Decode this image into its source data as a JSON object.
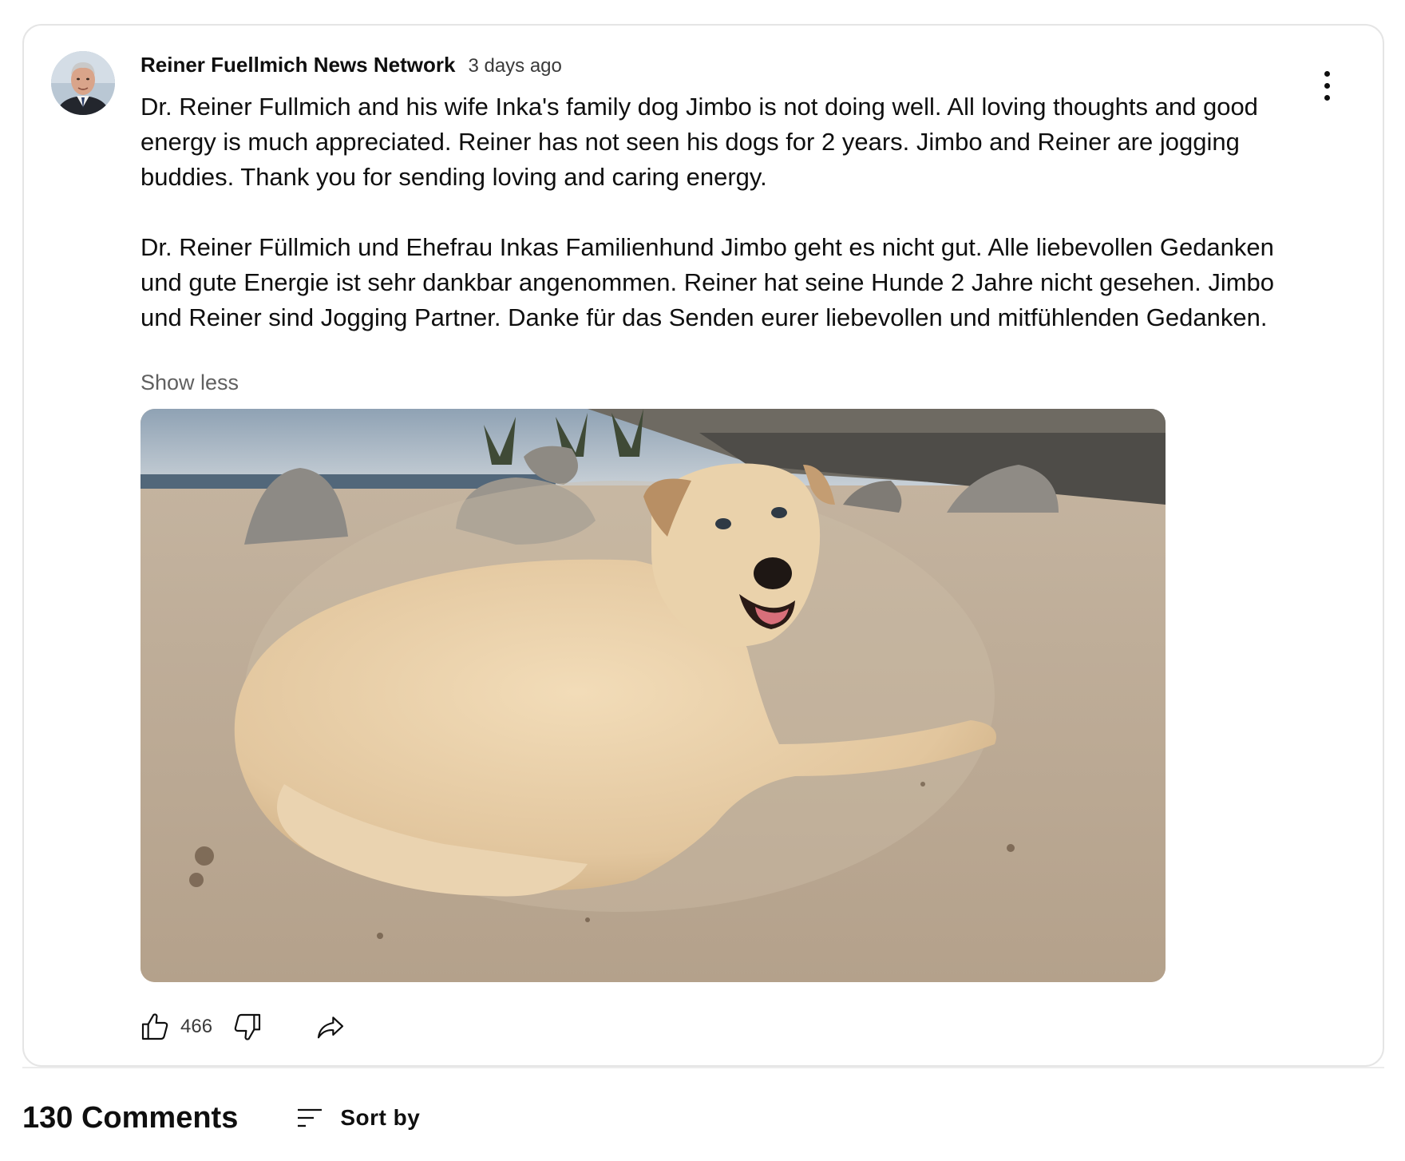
{
  "post": {
    "channel_name": "Reiner Fuellmich News Network",
    "time": "3 days ago",
    "paragraphs": [
      "Dr. Reiner Fullmich and his wife Inka's family dog Jimbo is not doing well. All loving thoughts and good energy is much appreciated. Reiner has not seen his dogs for 2 years. Jimbo and Reiner are jogging buddies. Thank you for sending loving and caring energy.",
      "Dr. Reiner Füllmich und Ehefrau Inkas Familienhund Jimbo geht es nicht gut. Alle liebevollen Gedanken und gute Energie ist sehr dankbar angenommen. Reiner hat seine Hunde 2 Jahre nicht gesehen. Jimbo und Reiner sind Jogging Partner. Danke für das Senden eurer liebevollen und mitfühlenden Gedanken."
    ],
    "show_less_label": "Show less",
    "like_count": "466"
  },
  "comments": {
    "count_label": "130 Comments",
    "sort_label": "Sort by"
  },
  "icons": {
    "avatar": "channel-avatar",
    "menu": "more-vert-icon",
    "like": "thumbs-up-icon",
    "dislike": "thumbs-down-icon",
    "share": "share-icon",
    "sort": "sort-icon"
  },
  "colors": {
    "text": "#0f0f0f",
    "secondary_text": "#606060",
    "border": "#e5e5e5"
  }
}
